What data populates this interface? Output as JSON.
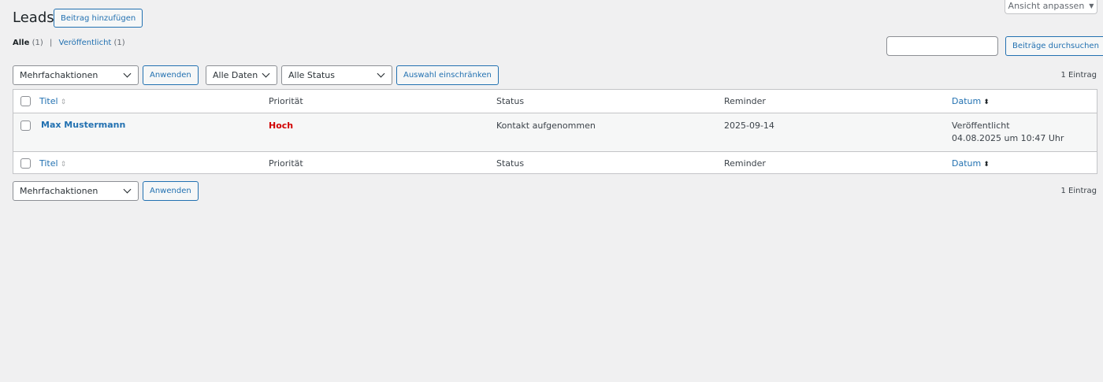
{
  "screen_options": {
    "label": "Ansicht anpassen",
    "caret": "▼"
  },
  "header": {
    "title": "Leads",
    "add_new_label": "Beitrag hinzufügen"
  },
  "views": {
    "all_label": "Alle",
    "all_count": "(1)",
    "separator": "|",
    "published_label": "Veröffentlicht",
    "published_count": "(1)"
  },
  "search": {
    "value": "",
    "button_label": "Beiträge durchsuchen"
  },
  "top_nav": {
    "bulk_action": "Mehrfachaktionen",
    "apply_label": "Anwenden",
    "date_filter": "Alle Daten",
    "status_filter": "Alle Status",
    "filter_label": "Auswahl einschränken",
    "count": "1 Eintrag"
  },
  "columns": {
    "title": "Titel",
    "priority": "Priorität",
    "status": "Status",
    "reminder": "Reminder",
    "date": "Datum",
    "sort_icon": "⇕",
    "sort_icon_active": "⬍"
  },
  "rows": [
    {
      "title": "Max Mustermann",
      "priority": "Hoch",
      "priority_color": "#d10000",
      "status": "Kontakt aufgenommen",
      "reminder": "2025-09-14",
      "date_status": "Veröffentlicht",
      "date_value": "04.08.2025 um 10:47 Uhr"
    }
  ],
  "bottom_nav": {
    "bulk_action": "Mehrfachaktionen",
    "apply_label": "Anwenden",
    "count": "1 Eintrag"
  },
  "colors": {
    "link": "#2271b1",
    "background": "#f0f0f1",
    "border": "#c3c4c7"
  }
}
